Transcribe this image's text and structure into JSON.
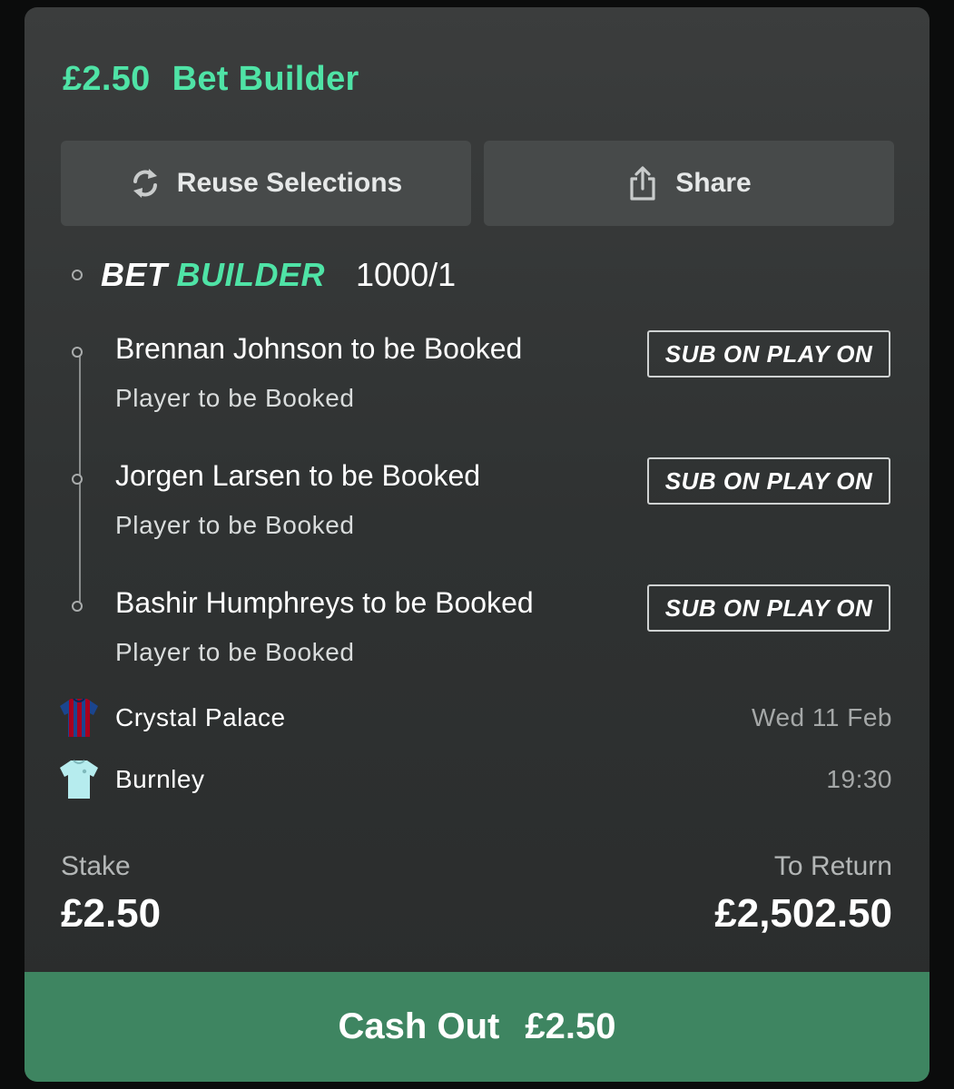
{
  "header": {
    "stake": "£2.50",
    "bet_type": "Bet Builder"
  },
  "actions": {
    "reuse_label": "Reuse Selections",
    "share_label": "Share"
  },
  "bet_builder": {
    "logo_word1": "BET",
    "logo_word2": "BUILDER",
    "odds": "1000/1"
  },
  "selections": [
    {
      "title": "Brennan Johnson to be Booked",
      "market": "Player to be Booked",
      "badge": "SUB ON PLAY ON"
    },
    {
      "title": "Jorgen Larsen to be Booked",
      "market": "Player to be Booked",
      "badge": "SUB ON PLAY ON"
    },
    {
      "title": "Bashir Humphreys to be Booked",
      "market": "Player to be Booked",
      "badge": "SUB ON PLAY ON"
    }
  ],
  "match": {
    "home": {
      "name": "Crystal Palace",
      "kit_colors": [
        "#1b458f",
        "#a7001e"
      ]
    },
    "away": {
      "name": "Burnley",
      "kit_colors": [
        "#b6ecee"
      ]
    },
    "date": "Wed 11 Feb",
    "time": "19:30"
  },
  "summary": {
    "stake_label": "Stake",
    "stake_value": "£2.50",
    "return_label": "To Return",
    "return_value": "£2,502.50"
  },
  "cashout": {
    "label": "Cash Out",
    "amount": "£2.50"
  },
  "colors": {
    "accent": "#4fe3a6",
    "cashout_bg": "#3e8561",
    "card_bg": "#333636"
  }
}
